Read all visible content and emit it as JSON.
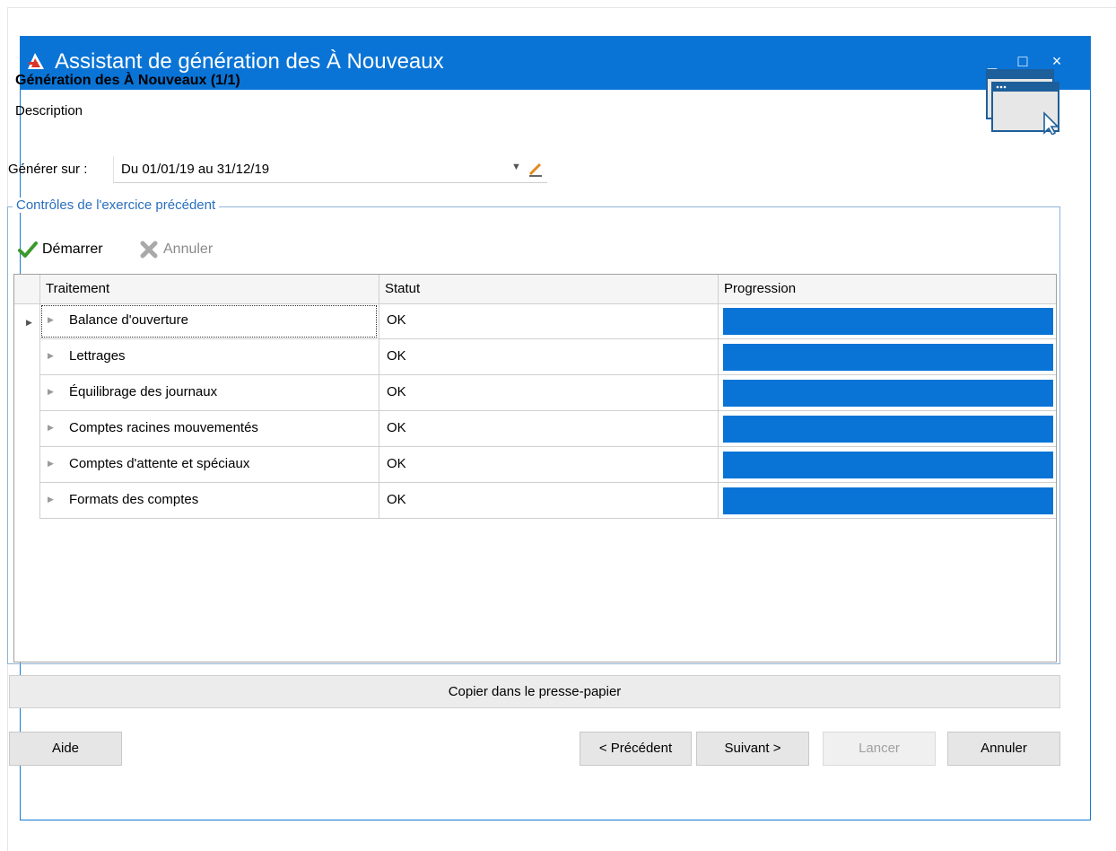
{
  "window": {
    "title": "Assistant de génération des À Nouveaux",
    "controls": {
      "minimize": "_",
      "maximize": "□",
      "close": "×"
    }
  },
  "step": {
    "title": "Génération des À Nouveaux (1/1)",
    "description": "Description"
  },
  "generate_on": {
    "label": "Générer sur :",
    "value": "Du 01/01/19 au 31/12/19"
  },
  "group": {
    "title": "Contrôles de l'exercice précédent",
    "toolbar": {
      "start_label": "Démarrer",
      "cancel_label": "Annuler"
    }
  },
  "table": {
    "columns": [
      "Traitement",
      "Statut",
      "Progression"
    ],
    "rows": [
      {
        "name": "Balance d'ouverture",
        "status": "OK",
        "progress": 1.0
      },
      {
        "name": "Lettrages",
        "status": "OK",
        "progress": 1.0
      },
      {
        "name": "Équilibrage des journaux",
        "status": "OK",
        "progress": 1.0
      },
      {
        "name": "Comptes racines mouvementés",
        "status": "OK",
        "progress": 1.0
      },
      {
        "name": "Comptes d'attente et spéciaux",
        "status": "OK",
        "progress": 1.0
      },
      {
        "name": "Formats des comptes",
        "status": "OK",
        "progress": 1.0
      }
    ]
  },
  "copy_button": "Copier dans le presse-papier",
  "footer": {
    "help": "Aide",
    "previous": "< Précédent",
    "next": "Suivant >",
    "launch": "Lancer",
    "cancel": "Annuler"
  },
  "colors": {
    "accent": "#0a74d6",
    "progress_fill": "#0a74d6",
    "group_title": "#2a6fbd",
    "disabled_text": "#a0a0a0"
  },
  "icons": {
    "app": "app-logo-icon",
    "wizard": "window-cursor-icon",
    "start": "checkmark-icon",
    "cancel": "x-icon",
    "combo_dropdown": "chevron-down-icon",
    "combo_edit": "pencil-icon"
  }
}
